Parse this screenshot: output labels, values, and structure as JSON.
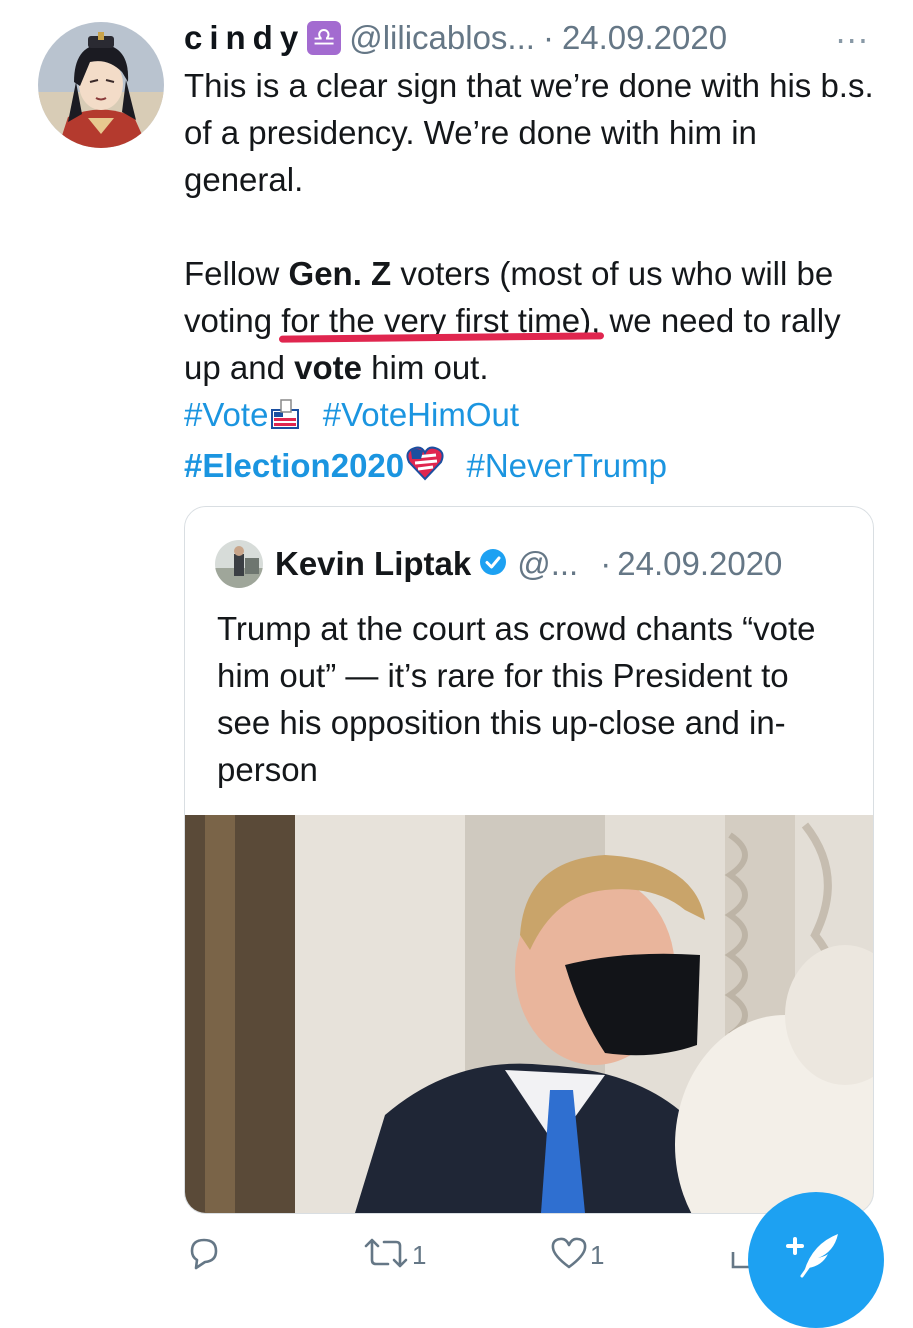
{
  "tweet": {
    "author_name": "cindy",
    "zodiac_symbol": "♎",
    "handle": "@lilicablos...",
    "separator": "·",
    "date": "24.09.2020",
    "more_icon": "···",
    "text": {
      "line1": "This is a clear sign that we’re done with his b.s. of a presidency. We’re done with him in general.",
      "p2_fellow": "Fellow ",
      "p2_genz": "Gen. Z",
      "p2_voters": " voters (most of us who will be voting ",
      "p2_underlined": "for the very first time),",
      "p2_after": " we need to rally up and ",
      "p2_vote": "vote",
      "p2_end": " him out."
    },
    "hashtags": [
      "#Vote",
      "#VoteHimOut",
      "#Election2020",
      "#NeverTrump"
    ]
  },
  "quoted_tweet": {
    "author_name": "Kevin Liptak",
    "handle": "@...",
    "separator": "·",
    "date": "24.09.2020",
    "text": "Trump at the court as crowd chants “vote him out” — it’s rare for this President to see his opposition this up-close and in-person"
  },
  "actions": {
    "reply_count": "",
    "retweet_count": "1",
    "like_count": "1"
  },
  "colors": {
    "link": "#1b95e0",
    "accent": "#1da1f2",
    "underline_mark": "#e0264f",
    "secondary_text": "#657786"
  },
  "icons": {
    "reply": "reply-icon",
    "retweet": "retweet-icon",
    "like": "heart-icon",
    "share": "share-icon",
    "compose": "compose-feather-icon",
    "verified": "verified-badge-icon"
  }
}
